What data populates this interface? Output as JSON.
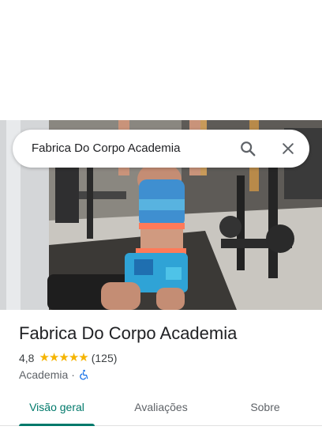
{
  "search": {
    "query": "Fabrica Do Corpo Academia",
    "search_icon": "search-icon",
    "close_icon": "close-icon"
  },
  "place": {
    "name": "Fabrica Do Corpo Academia",
    "rating": "4,8",
    "stars": 5,
    "review_count": "(125)",
    "category": "Academia",
    "separator": "·",
    "accessibility_icon": "wheelchair-icon"
  },
  "tabs": [
    {
      "label": "Visão geral",
      "active": true
    },
    {
      "label": "Avaliações",
      "active": false
    },
    {
      "label": "Sobre",
      "active": false
    }
  ],
  "colors": {
    "accent": "#00796b",
    "star": "#f5b400",
    "accessibility": "#1a73e8"
  }
}
